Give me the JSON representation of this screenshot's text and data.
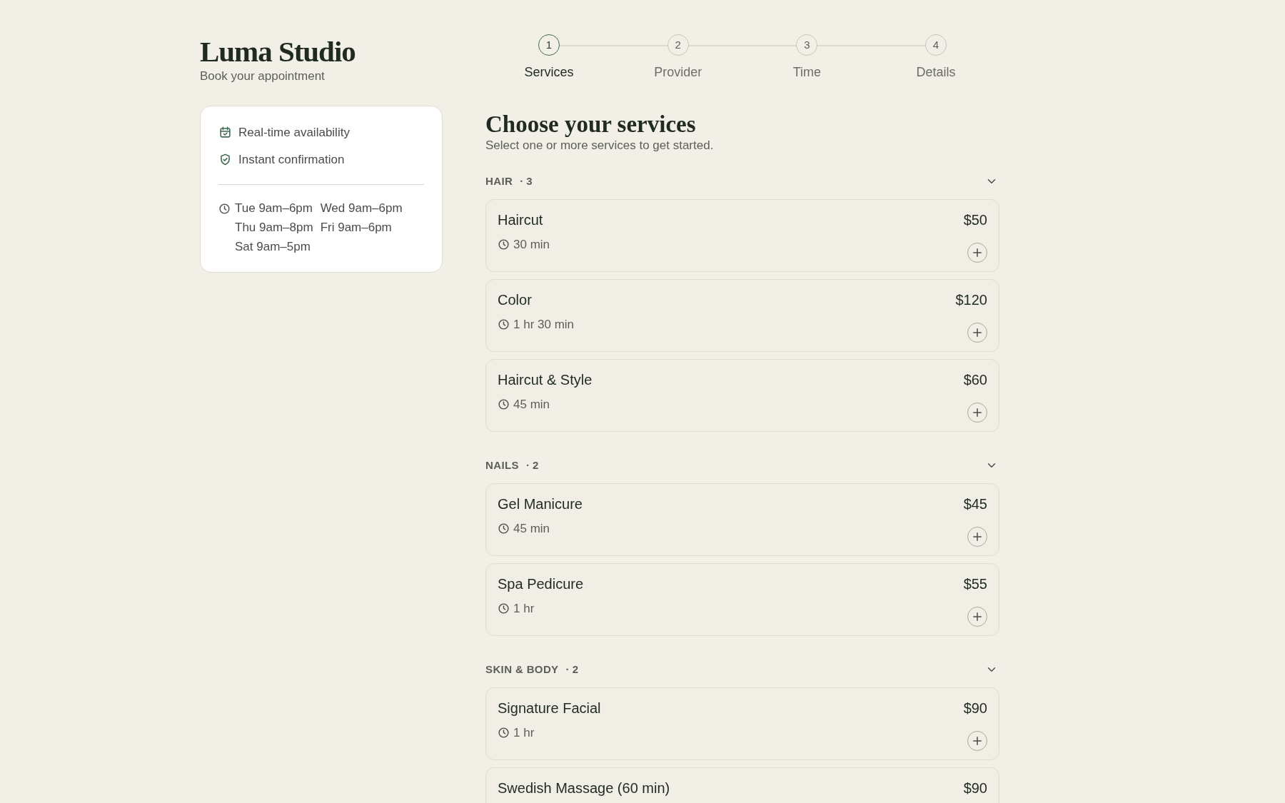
{
  "brand": {
    "title": "Luma Studio",
    "subtitle": "Book your appointment"
  },
  "info": {
    "features": [
      {
        "kind": "calendar",
        "label": "Real-time availability"
      },
      {
        "kind": "shield",
        "label": "Instant confirmation"
      }
    ],
    "hours": [
      "Tue 9am–6pm",
      "Wed 9am–6pm",
      "Thu 9am–8pm",
      "Fri 9am–6pm",
      "Sat 9am–5pm"
    ]
  },
  "steps": [
    {
      "number": "1",
      "label": "Services",
      "selected": true
    },
    {
      "number": "2",
      "label": "Provider",
      "selected": false
    },
    {
      "number": "3",
      "label": "Time",
      "selected": false
    },
    {
      "number": "4",
      "label": "Details",
      "selected": false
    }
  ],
  "heading": "Choose your services",
  "subheading": "Select one or more services to get started.",
  "categories": [
    {
      "name": "HAIR",
      "count": "· 3",
      "expanded": true,
      "services": [
        {
          "name": "Haircut",
          "duration": "30 min",
          "price": "$50",
          "selected": false
        },
        {
          "name": "Color",
          "duration": "1 hr 30 min",
          "price": "$120",
          "selected": false
        },
        {
          "name": "Haircut & Style",
          "duration": "45 min",
          "price": "$60",
          "selected": false
        }
      ]
    },
    {
      "name": "NAILS",
      "count": "· 2",
      "expanded": true,
      "services": [
        {
          "name": "Gel Manicure",
          "duration": "45 min",
          "price": "$45",
          "selected": false
        },
        {
          "name": "Spa Pedicure",
          "duration": "1 hr",
          "price": "$55",
          "selected": false
        }
      ]
    },
    {
      "name": "SKIN & BODY",
      "count": "· 2",
      "expanded": true,
      "services": [
        {
          "name": "Signature Facial",
          "duration": "1 hr",
          "price": "$90",
          "selected": false
        },
        {
          "name": "Swedish Massage (60 min)",
          "price": "$90",
          "selected": false
        }
      ]
    }
  ]
}
